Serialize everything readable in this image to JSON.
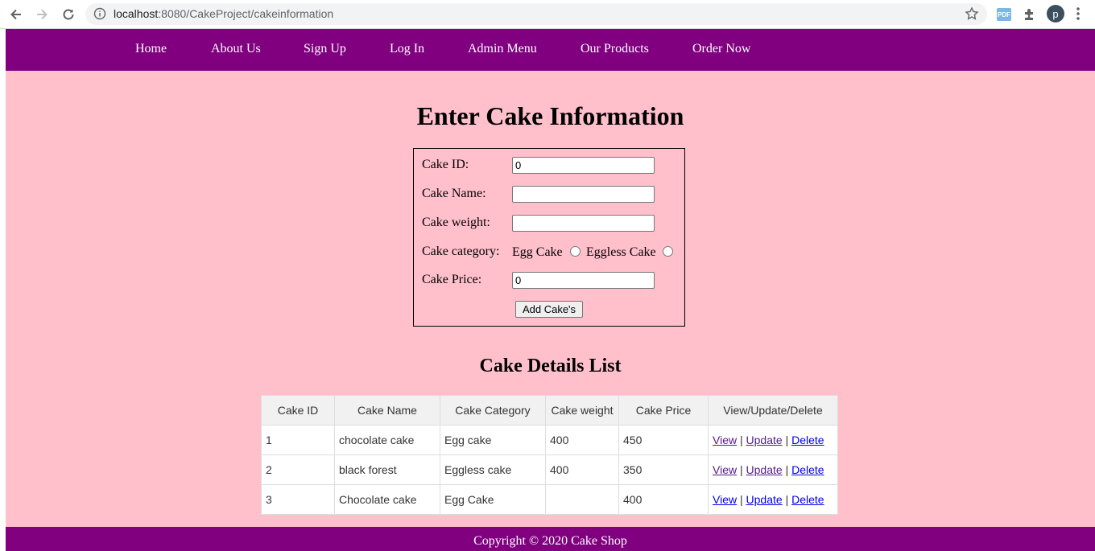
{
  "browser": {
    "url_host": "localhost",
    "url_rest": ":8080/CakeProject/cakeinformation",
    "profile_initial": "p"
  },
  "nav": {
    "items": [
      "Home",
      "About Us",
      "Sign Up",
      "Log In",
      "Admin Menu",
      "Our Products",
      "Order Now"
    ]
  },
  "form": {
    "title": "Enter Cake Information",
    "cake_id_label": "Cake ID:",
    "cake_id_value": "0",
    "cake_name_label": "Cake Name:",
    "cake_name_value": "",
    "cake_weight_label": "Cake weight:",
    "cake_weight_value": "",
    "cake_category_label": "Cake category:",
    "category_option_1": "Egg Cake",
    "category_option_2": "Eggless Cake",
    "cake_price_label": "Cake Price:",
    "cake_price_value": "0",
    "submit_label": "Add Cake's"
  },
  "list": {
    "title": "Cake Details List",
    "columns": [
      "Cake ID",
      "Cake Name",
      "Cake Category",
      "Cake weight",
      "Cake Price",
      "View/Update/Delete"
    ],
    "rows": [
      {
        "id": "1",
        "name": "chocolate cake",
        "category": "Egg cake",
        "weight": "400",
        "price": "450"
      },
      {
        "id": "2",
        "name": "black forest",
        "category": "Eggless cake",
        "weight": "400",
        "price": "350"
      },
      {
        "id": "3",
        "name": "Chocolate cake",
        "category": "Egg Cake",
        "weight": "",
        "price": "400"
      }
    ],
    "action_view": "View",
    "action_update": "Update",
    "action_delete": "Delete",
    "separator": "|"
  },
  "footer": {
    "text": "Copyright © 2020 Cake Shop"
  },
  "colors": {
    "nav_bg": "#800080",
    "page_bg": "#ffc0cb"
  }
}
